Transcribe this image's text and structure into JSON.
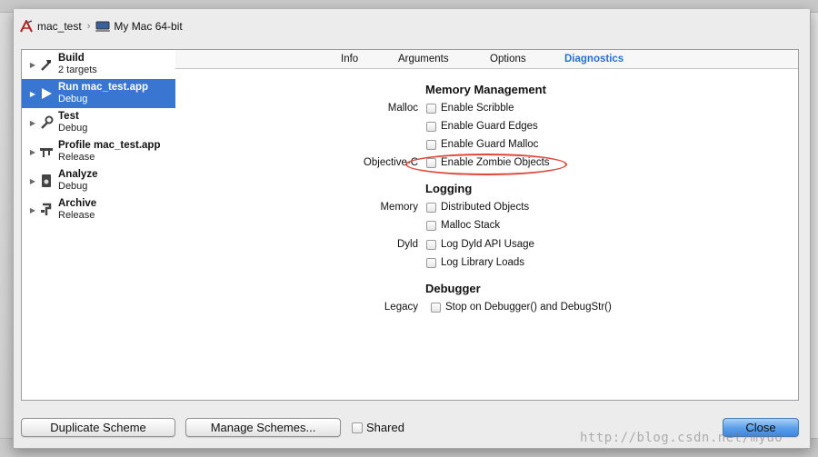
{
  "breadcrumb": {
    "project": "mac_test",
    "destination": "My Mac 64-bit"
  },
  "schemes": [
    {
      "name": "Build",
      "sub": "2 targets",
      "icon": "hammer-icon",
      "selected": false
    },
    {
      "name": "Run mac_test.app",
      "sub": "Debug",
      "icon": "play-icon",
      "selected": true
    },
    {
      "name": "Test",
      "sub": "Debug",
      "icon": "wrench-icon",
      "selected": false
    },
    {
      "name": "Profile mac_test.app",
      "sub": "Release",
      "icon": "caliper-icon",
      "selected": false
    },
    {
      "name": "Analyze",
      "sub": "Debug",
      "icon": "analyze-icon",
      "selected": false
    },
    {
      "name": "Archive",
      "sub": "Release",
      "icon": "archive-icon",
      "selected": false
    }
  ],
  "tabs": [
    "Info",
    "Arguments",
    "Options",
    "Diagnostics"
  ],
  "active_tab": "Diagnostics",
  "sections": {
    "memory_management": {
      "title": "Memory Management",
      "malloc_label": "Malloc",
      "objc_label": "Objective-C",
      "enable_scribble": "Enable Scribble",
      "enable_guard_edges": "Enable Guard Edges",
      "enable_guard_malloc": "Enable Guard Malloc",
      "enable_zombie_objects": "Enable Zombie Objects"
    },
    "logging": {
      "title": "Logging",
      "memory_label": "Memory",
      "dyld_label": "Dyld",
      "distributed_objects": "Distributed Objects",
      "malloc_stack": "Malloc Stack",
      "log_dyld_api_usage": "Log Dyld API Usage",
      "log_library_loads": "Log Library Loads"
    },
    "debugger": {
      "title": "Debugger",
      "legacy_label": "Legacy",
      "stop_on_debugger": "Stop on Debugger() and DebugStr()"
    }
  },
  "buttons": {
    "duplicate_scheme": "Duplicate Scheme",
    "manage_schemes": "Manage Schemes...",
    "shared": "Shared",
    "close": "Close"
  },
  "watermark": "http://blog.csdn.net/myuo",
  "colors": {
    "selection": "#3876d2",
    "active_tab": "#2a6fce",
    "highlight": "#e0453a"
  }
}
